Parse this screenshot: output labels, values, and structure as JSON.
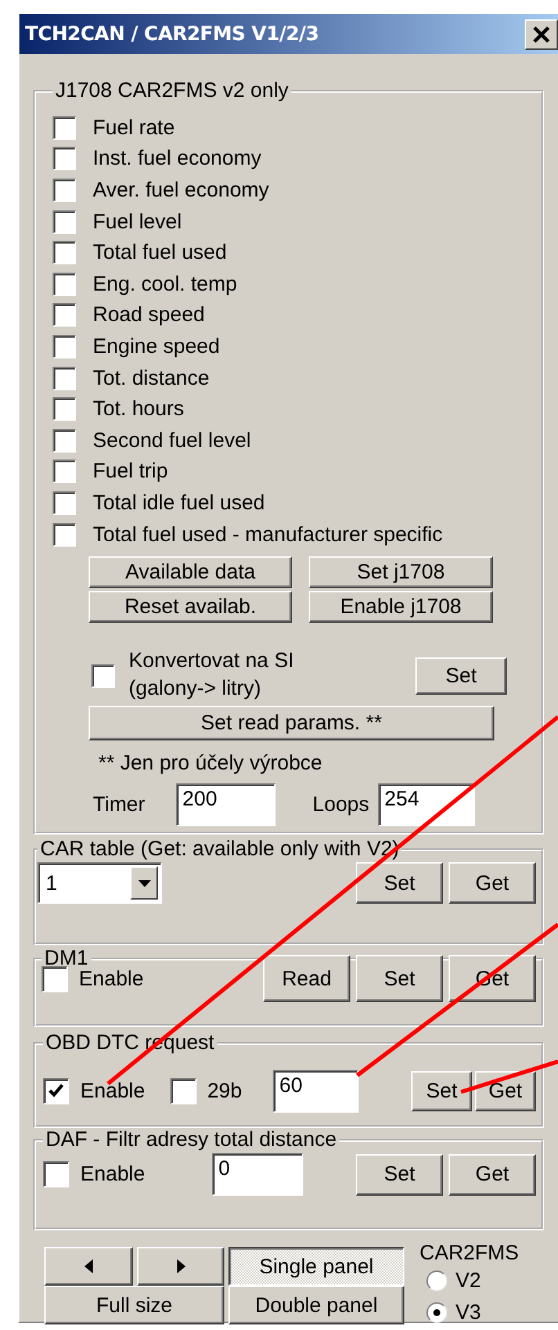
{
  "window": {
    "title": "TCH2CAN / CAR2FMS V1/2/3"
  },
  "j1708": {
    "title": "J1708 CAR2FMS v2 only",
    "items": [
      {
        "label": "Fuel rate",
        "checked": false
      },
      {
        "label": "Inst. fuel economy",
        "checked": false
      },
      {
        "label": "Aver. fuel economy",
        "checked": false
      },
      {
        "label": "Fuel level",
        "checked": false
      },
      {
        "label": "Total fuel used",
        "checked": false
      },
      {
        "label": "Eng. cool. temp",
        "checked": false
      },
      {
        "label": "Road speed",
        "checked": false
      },
      {
        "label": "Engine speed",
        "checked": false
      },
      {
        "label": "Tot. distance",
        "checked": false
      },
      {
        "label": "Tot. hours",
        "checked": false
      },
      {
        "label": "Second fuel level",
        "checked": false
      },
      {
        "label": "Fuel trip",
        "checked": false
      },
      {
        "label": "Total idle fuel used",
        "checked": false
      },
      {
        "label": "Total fuel used - manufacturer specific",
        "checked": false
      }
    ],
    "buttons": [
      "Available data",
      "Set j1708",
      "Reset availab.",
      "Enable j1708"
    ],
    "convert": {
      "lines": [
        "Konvertovat na SI",
        "(galony-> litry)"
      ],
      "checked": false,
      "button": "Set"
    },
    "read_params_button": "Set read params. **",
    "note": "** Jen pro účely výrobce",
    "timer": {
      "label": "Timer",
      "value": "200"
    },
    "loops": {
      "label": "Loops",
      "value": "254"
    }
  },
  "car_table": {
    "title": "CAR table (Get: available only with V2)",
    "select": "1",
    "buttons": [
      "Set",
      "Get"
    ]
  },
  "dm1": {
    "title": "DM1",
    "enable": {
      "label": "Enable",
      "checked": false
    },
    "buttons": [
      "Read",
      "Set",
      "Get"
    ]
  },
  "obd": {
    "title": "OBD DTC request",
    "enable": {
      "label": "Enable",
      "checked": true
    },
    "bits29": {
      "label": "29b",
      "checked": false
    },
    "value": "60",
    "buttons": [
      "Set",
      "Get"
    ]
  },
  "daf": {
    "title": "DAF - Filtr adresy total distance",
    "enable": {
      "label": "Enable",
      "checked": false
    },
    "value": "0",
    "buttons": [
      "Set",
      "Get"
    ]
  },
  "bottom": {
    "full_size": "Full size",
    "panels": [
      {
        "label": "Single panel",
        "selected": true
      },
      {
        "label": "Double panel",
        "selected": false
      }
    ],
    "car2fms": {
      "title": "CAR2FMS",
      "options": [
        {
          "label": "V2",
          "selected": false
        },
        {
          "label": "V3",
          "selected": true
        }
      ]
    }
  }
}
